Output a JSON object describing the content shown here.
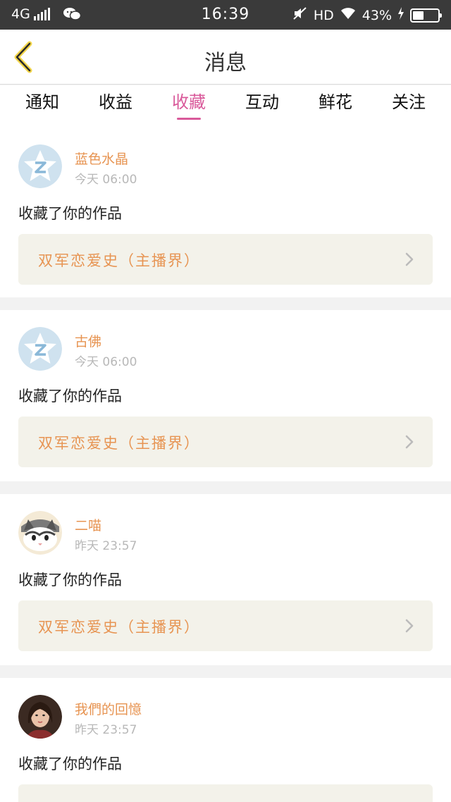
{
  "status_bar": {
    "network": "4G",
    "time": "16:39",
    "hd": "HD",
    "battery_text": "43%",
    "battery_level": 0.43
  },
  "nav": {
    "title": "消息"
  },
  "tabs": [
    {
      "label": "通知",
      "active": false
    },
    {
      "label": "收益",
      "active": false
    },
    {
      "label": "收藏",
      "active": true
    },
    {
      "label": "互动",
      "active": false
    },
    {
      "label": "鲜花",
      "active": false
    },
    {
      "label": "关注",
      "active": false
    }
  ],
  "messages": [
    {
      "username": "蓝色水晶",
      "time": "今天 06:00",
      "action": "收藏了你的作品",
      "work": "双军恋爱史（主播界）",
      "avatar": "qq-default-avatar"
    },
    {
      "username": "古佛",
      "time": "今天 06:00",
      "action": "收藏了你的作品",
      "work": "双军恋爱史（主播界）",
      "avatar": "qq-default-avatar"
    },
    {
      "username": "二喵",
      "time": "昨天 23:57",
      "action": "收藏了你的作品",
      "work": "双军恋爱史（主播界）",
      "avatar": "cat-avatar"
    },
    {
      "username": "我們的回憶",
      "time": "昨天 23:57",
      "action": "收藏了你的作品",
      "work": "",
      "avatar": "photo-avatar"
    }
  ],
  "colors": {
    "accent": "#d9599a",
    "username": "#e79452",
    "status_bar": "#3a3a3a"
  }
}
